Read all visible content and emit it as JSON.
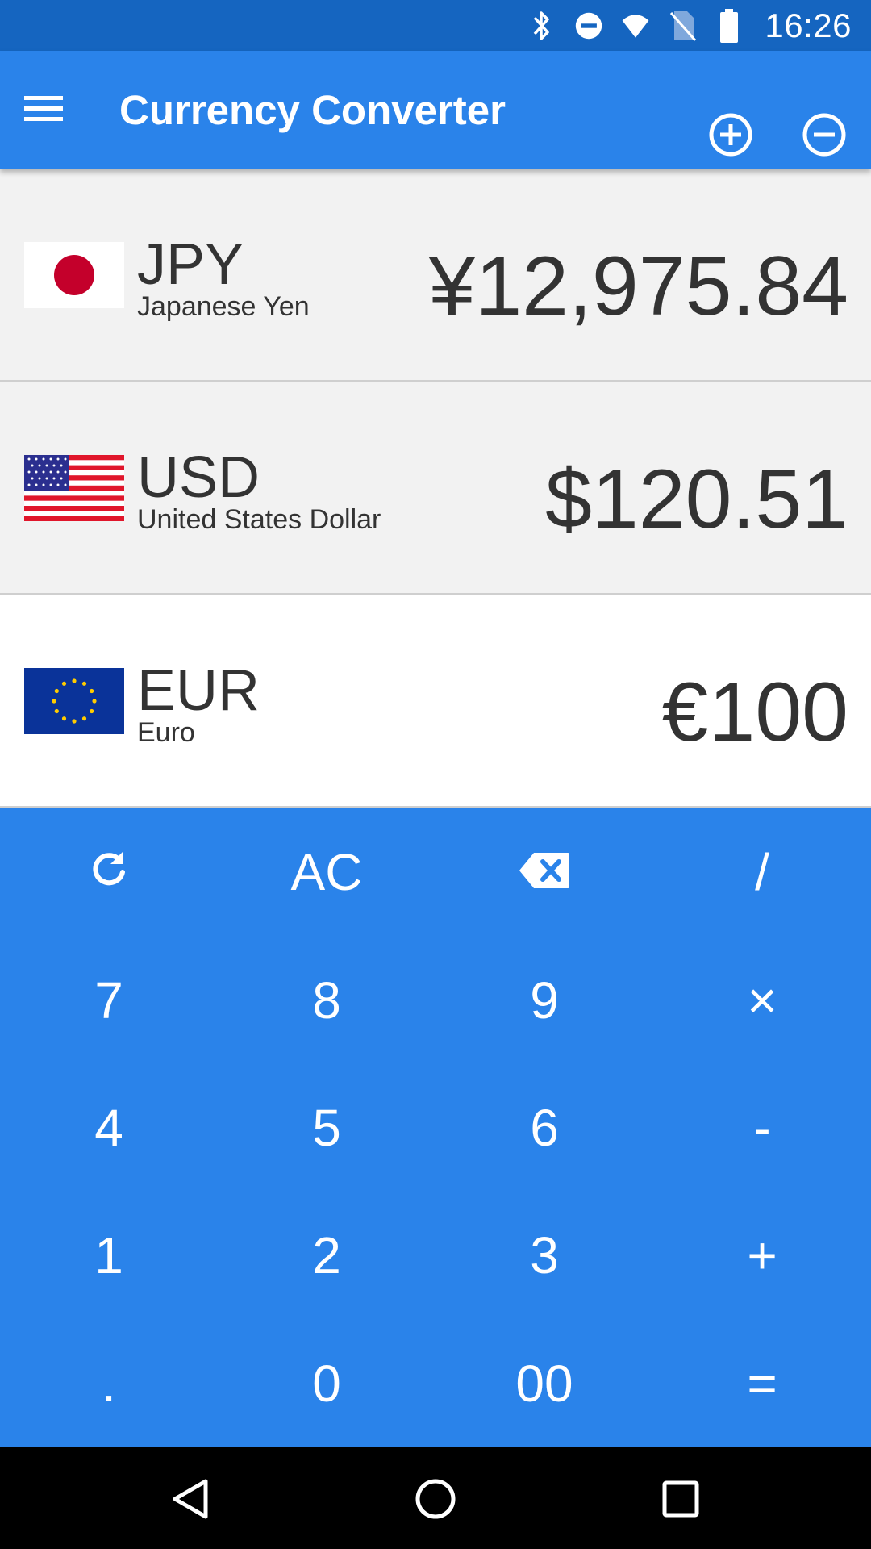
{
  "status_bar": {
    "time": "16:26",
    "icons": [
      "bluetooth-icon",
      "do-not-disturb-icon",
      "wifi-icon",
      "no-sim-icon",
      "battery-icon"
    ]
  },
  "app_bar": {
    "title": "Currency Converter",
    "icons": [
      "menu-icon",
      "add-circle-icon",
      "remove-circle-icon"
    ]
  },
  "currencies": [
    {
      "code": "JPY",
      "name": "Japanese Yen",
      "amount": "¥12,975.84",
      "flag": "japan-flag"
    },
    {
      "code": "USD",
      "name": "United States Dollar",
      "amount": "$120.51",
      "flag": "usa-flag"
    },
    {
      "code": "EUR",
      "name": "Euro",
      "amount": "€100",
      "flag": "eu-flag",
      "active": true
    }
  ],
  "keypad": {
    "keys": [
      {
        "label": "",
        "icon": "refresh-icon",
        "name": "refresh-key"
      },
      {
        "label": "AC",
        "name": "clear-key"
      },
      {
        "label": "",
        "icon": "backspace-icon",
        "name": "backspace-key"
      },
      {
        "label": "/",
        "name": "divide-key"
      },
      {
        "label": "7",
        "name": "key-7"
      },
      {
        "label": "8",
        "name": "key-8"
      },
      {
        "label": "9",
        "name": "key-9"
      },
      {
        "label": "×",
        "name": "multiply-key"
      },
      {
        "label": "4",
        "name": "key-4"
      },
      {
        "label": "5",
        "name": "key-5"
      },
      {
        "label": "6",
        "name": "key-6"
      },
      {
        "label": "-",
        "name": "subtract-key"
      },
      {
        "label": "1",
        "name": "key-1"
      },
      {
        "label": "2",
        "name": "key-2"
      },
      {
        "label": "3",
        "name": "key-3"
      },
      {
        "label": "+",
        "name": "add-key"
      },
      {
        "label": ".",
        "name": "decimal-key"
      },
      {
        "label": "0",
        "name": "key-0"
      },
      {
        "label": "00",
        "name": "key-00"
      },
      {
        "label": "=",
        "name": "equals-key"
      }
    ]
  },
  "nav_bar": {
    "icons": [
      "back-icon",
      "home-icon",
      "recents-icon"
    ]
  },
  "colors": {
    "status_bar": "#1565c0",
    "primary": "#2a83ea",
    "row_bg": "#f2f2f2",
    "row_active_bg": "#ffffff",
    "text": "#333333"
  }
}
